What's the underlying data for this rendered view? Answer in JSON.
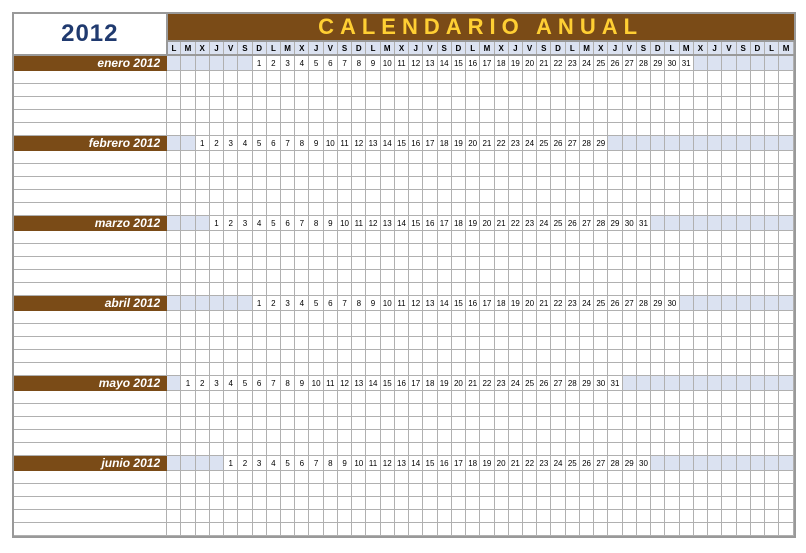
{
  "year": "2012",
  "title": "CALENDARIO  ANUAL",
  "columns": 44,
  "dow": [
    "L",
    "M",
    "X",
    "J",
    "V",
    "S",
    "D",
    "L",
    "M",
    "X",
    "J",
    "V",
    "S",
    "D",
    "L",
    "M",
    "X",
    "J",
    "V",
    "S",
    "D",
    "L",
    "M",
    "X",
    "J",
    "V",
    "S",
    "D",
    "L",
    "M",
    "X",
    "J",
    "V",
    "S",
    "D",
    "L",
    "M",
    "X",
    "J",
    "V",
    "S",
    "D",
    "L",
    "M"
  ],
  "months": [
    {
      "label": "enero 2012",
      "pad": 6,
      "days": 31
    },
    {
      "label": "febrero 2012",
      "pad": 2,
      "days": 29
    },
    {
      "label": "marzo 2012",
      "pad": 3,
      "days": 31
    },
    {
      "label": "abril 2012",
      "pad": 6,
      "days": 30
    },
    {
      "label": "mayo 2012",
      "pad": 1,
      "days": 31
    },
    {
      "label": "junio 2012",
      "pad": 4,
      "days": 30
    }
  ],
  "blank_rows_per_month": 5
}
